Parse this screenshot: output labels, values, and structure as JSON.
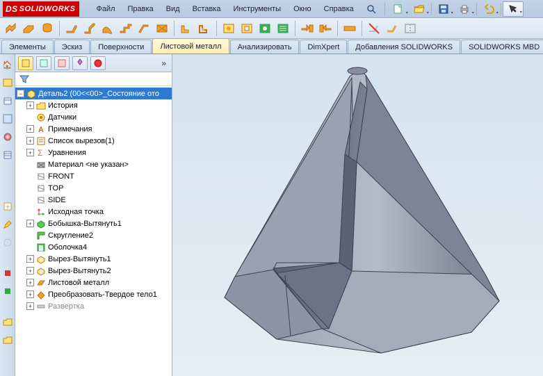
{
  "app": {
    "title": "SOLIDWORKS"
  },
  "menu": {
    "file": "Файл",
    "edit": "Правка",
    "view": "Вид",
    "insert": "Вставка",
    "tools": "Инструменты",
    "window": "Окно",
    "help": "Справка"
  },
  "tabs": {
    "t0": "Элементы",
    "t1": "Эскиз",
    "t2": "Поверхности",
    "t3": "Листовой металл",
    "t4": "Анализировать",
    "t5": "DimXpert",
    "t6": "Добавления SOLIDWORKS",
    "t7": "SOLIDWORKS MBD"
  },
  "tree": {
    "root": "Деталь2  (00<<00>_Состояние ото",
    "history": "История",
    "sensors": "Датчики",
    "annotations": "Примечания",
    "cutlist": "Список вырезов(1)",
    "equations": "Уравнения",
    "material": "Материал <не указан>",
    "front": "FRONT",
    "top": "TOP",
    "side": "SIDE",
    "origin": "Исходная точка",
    "boss1": "Бобышка-Вытянуть1",
    "fillet2": "Скругление2",
    "shell4": "Оболочка4",
    "cutext1": "Вырез-Вытянуть1",
    "cutext2": "Вырез-Вытянуть2",
    "sheetmetal": "Листовой металл",
    "convert": "Преобразовать-Твердое тело1",
    "flatten": "Развертка"
  }
}
